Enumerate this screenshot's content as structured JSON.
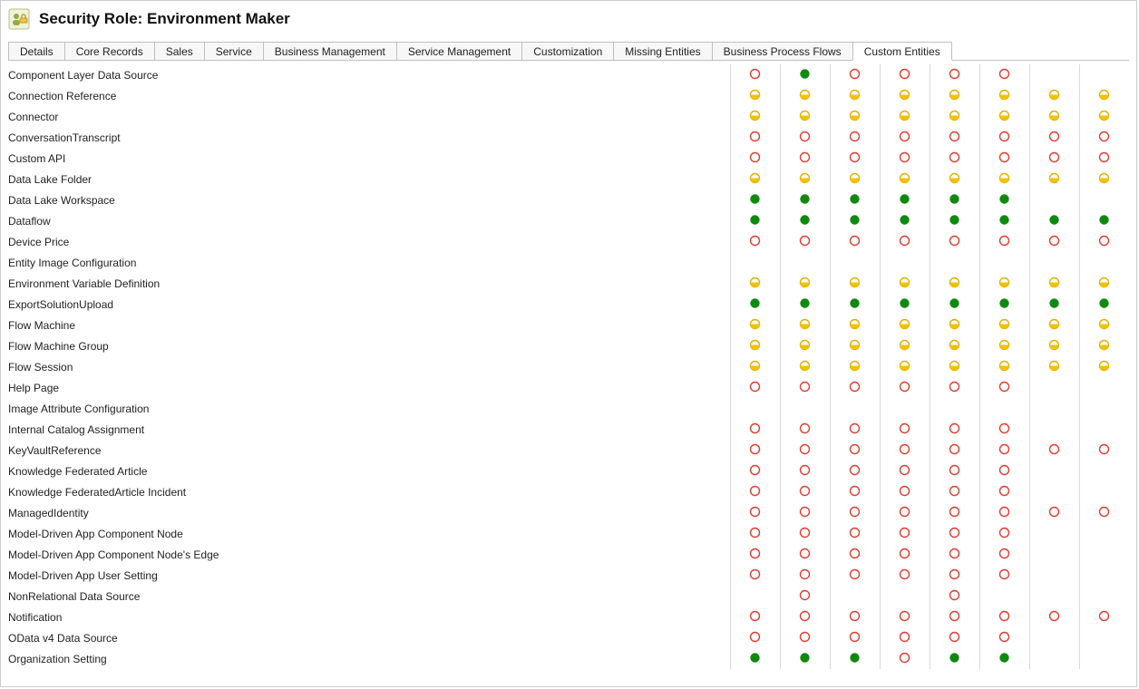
{
  "header": {
    "title": "Security Role: Environment Maker"
  },
  "tabs": [
    {
      "label": "Details"
    },
    {
      "label": "Core Records"
    },
    {
      "label": "Sales"
    },
    {
      "label": "Service"
    },
    {
      "label": "Business Management"
    },
    {
      "label": "Service Management"
    },
    {
      "label": "Customization"
    },
    {
      "label": "Missing Entities"
    },
    {
      "label": "Business Process Flows"
    },
    {
      "label": "Custom Entities",
      "active": true
    }
  ],
  "privilegeColumns": 8,
  "entities": [
    {
      "name": "Component Layer Data Source",
      "priv": [
        "none",
        "org",
        "none",
        "none",
        "none",
        "none",
        "",
        ""
      ]
    },
    {
      "name": "Connection Reference",
      "priv": [
        "half",
        "half",
        "half",
        "half",
        "half",
        "half",
        "half",
        "half"
      ]
    },
    {
      "name": "Connector",
      "priv": [
        "half",
        "half",
        "half",
        "half",
        "half",
        "half",
        "half",
        "half"
      ]
    },
    {
      "name": "ConversationTranscript",
      "priv": [
        "none",
        "none",
        "none",
        "none",
        "none",
        "none",
        "none",
        "none"
      ]
    },
    {
      "name": "Custom API",
      "priv": [
        "none",
        "none",
        "none",
        "none",
        "none",
        "none",
        "none",
        "none"
      ]
    },
    {
      "name": "Data Lake Folder",
      "priv": [
        "half",
        "half",
        "half",
        "half",
        "half",
        "half",
        "half",
        "half"
      ]
    },
    {
      "name": "Data Lake Workspace",
      "priv": [
        "org",
        "org",
        "org",
        "org",
        "org",
        "org",
        "",
        ""
      ]
    },
    {
      "name": "Dataflow",
      "priv": [
        "org",
        "org",
        "org",
        "org",
        "org",
        "org",
        "org",
        "org"
      ]
    },
    {
      "name": "Device Price",
      "priv": [
        "none",
        "none",
        "none",
        "none",
        "none",
        "none",
        "none",
        "none"
      ]
    },
    {
      "name": "Entity Image Configuration",
      "priv": [
        "",
        "",
        "",
        "",
        "",
        "",
        "",
        ""
      ]
    },
    {
      "name": "Environment Variable Definition",
      "priv": [
        "half",
        "half",
        "half",
        "half",
        "half",
        "half",
        "half",
        "half"
      ]
    },
    {
      "name": "ExportSolutionUpload",
      "priv": [
        "org",
        "org",
        "org",
        "org",
        "org",
        "org",
        "org",
        "org"
      ]
    },
    {
      "name": "Flow Machine",
      "priv": [
        "half",
        "half",
        "half",
        "half",
        "half",
        "half",
        "half",
        "half"
      ]
    },
    {
      "name": "Flow Machine Group",
      "priv": [
        "half",
        "half",
        "half",
        "half",
        "half",
        "half",
        "half",
        "half"
      ]
    },
    {
      "name": "Flow Session",
      "priv": [
        "half",
        "half",
        "half",
        "half",
        "half",
        "half",
        "half",
        "half"
      ]
    },
    {
      "name": "Help Page",
      "priv": [
        "none",
        "none",
        "none",
        "none",
        "none",
        "none",
        "",
        ""
      ]
    },
    {
      "name": "Image Attribute Configuration",
      "priv": [
        "",
        "",
        "",
        "",
        "",
        "",
        "",
        ""
      ]
    },
    {
      "name": "Internal Catalog Assignment",
      "priv": [
        "none",
        "none",
        "none",
        "none",
        "none",
        "none",
        "",
        ""
      ]
    },
    {
      "name": "KeyVaultReference",
      "priv": [
        "none",
        "none",
        "none",
        "none",
        "none",
        "none",
        "none",
        "none"
      ]
    },
    {
      "name": "Knowledge Federated Article",
      "priv": [
        "none",
        "none",
        "none",
        "none",
        "none",
        "none",
        "",
        ""
      ]
    },
    {
      "name": "Knowledge FederatedArticle Incident",
      "priv": [
        "none",
        "none",
        "none",
        "none",
        "none",
        "none",
        "",
        ""
      ]
    },
    {
      "name": "ManagedIdentity",
      "priv": [
        "none",
        "none",
        "none",
        "none",
        "none",
        "none",
        "none",
        "none"
      ]
    },
    {
      "name": "Model-Driven App Component Node",
      "priv": [
        "none",
        "none",
        "none",
        "none",
        "none",
        "none",
        "",
        ""
      ]
    },
    {
      "name": "Model-Driven App Component Node's Edge",
      "priv": [
        "none",
        "none",
        "none",
        "none",
        "none",
        "none",
        "",
        ""
      ]
    },
    {
      "name": "Model-Driven App User Setting",
      "priv": [
        "none",
        "none",
        "none",
        "none",
        "none",
        "none",
        "",
        ""
      ]
    },
    {
      "name": "NonRelational Data Source",
      "priv": [
        "",
        "none",
        "",
        "",
        "none",
        "",
        "",
        ""
      ]
    },
    {
      "name": "Notification",
      "priv": [
        "none",
        "none",
        "none",
        "none",
        "none",
        "none",
        "none",
        "none"
      ]
    },
    {
      "name": "OData v4 Data Source",
      "priv": [
        "none",
        "none",
        "none",
        "none",
        "none",
        "none",
        "",
        ""
      ]
    },
    {
      "name": "Organization Setting",
      "priv": [
        "org",
        "org",
        "org",
        "none",
        "org",
        "org",
        "",
        ""
      ]
    }
  ]
}
